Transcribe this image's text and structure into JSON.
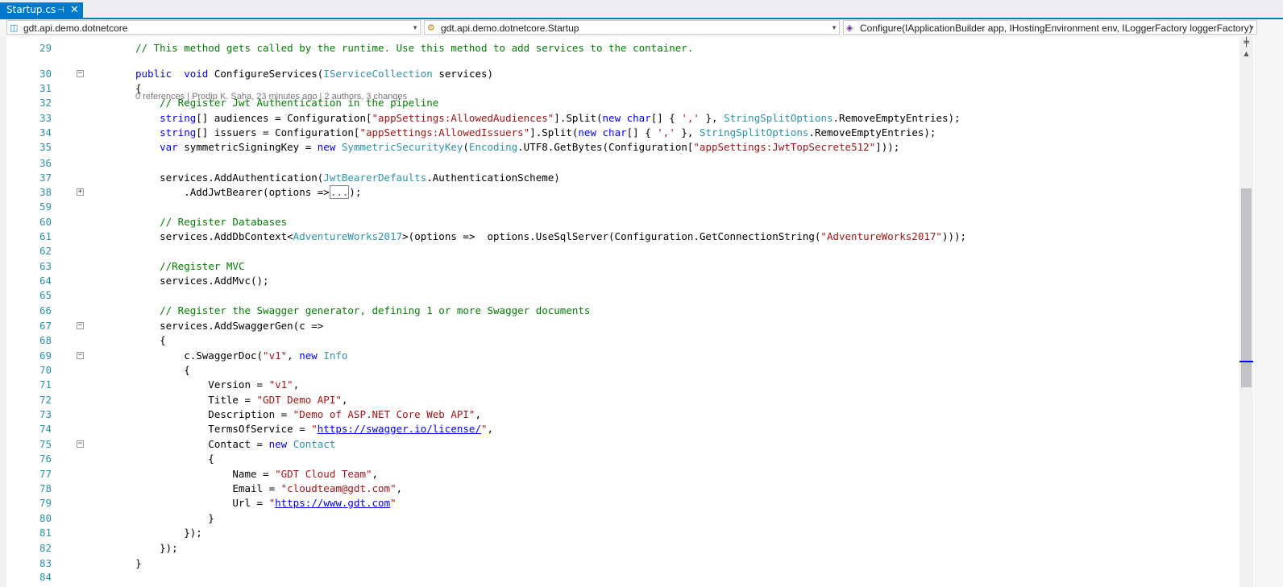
{
  "tab": {
    "title": "Startup.cs"
  },
  "nav": {
    "project": "gdt.api.demo.dotnetcore",
    "type": "gdt.api.demo.dotnetcore.Startup",
    "member": "Configure(IApplicationBuilder app, IHostingEnvironment env, ILoggerFactory loggerFactory)"
  },
  "codelens": "0 references | Prodip K. Saha, 23 minutes ago | 2 authors, 3 changes",
  "lines": [
    {
      "num": "29",
      "fold": "",
      "tokens": [
        [
          "cm",
          "// This method gets called by the runtime. Use this method to add services to the container."
        ]
      ]
    },
    {
      "num": "30",
      "fold": "-",
      "tokens": [
        [
          "kw",
          "public"
        ],
        [
          "",
          "  "
        ],
        [
          "kw",
          "void"
        ],
        [
          "",
          " ConfigureServices("
        ],
        [
          "ty",
          "IServiceCollection"
        ],
        [
          "",
          " services)"
        ]
      ]
    },
    {
      "num": "31",
      "fold": "",
      "tokens": [
        [
          "",
          "{"
        ]
      ]
    },
    {
      "num": "32",
      "fold": "",
      "tokens": [
        [
          "",
          "    "
        ],
        [
          "cm",
          "// Register Jwt Authentication in the pipeline"
        ]
      ]
    },
    {
      "num": "33",
      "fold": "",
      "tokens": [
        [
          "",
          "    "
        ],
        [
          "kw",
          "string"
        ],
        [
          "",
          "[] audiences = Configuration["
        ],
        [
          "str",
          "\"appSettings:AllowedAudiences\""
        ],
        [
          "",
          "].Split("
        ],
        [
          "kw",
          "new"
        ],
        [
          "",
          " "
        ],
        [
          "kw",
          "char"
        ],
        [
          "",
          "[] { "
        ],
        [
          "str",
          "','"
        ],
        [
          "",
          " }, "
        ],
        [
          "ty",
          "StringSplitOptions"
        ],
        [
          "",
          ".RemoveEmptyEntries);"
        ]
      ]
    },
    {
      "num": "34",
      "fold": "",
      "tokens": [
        [
          "",
          "    "
        ],
        [
          "kw",
          "string"
        ],
        [
          "",
          "[] issuers = Configuration["
        ],
        [
          "str",
          "\"appSettings:AllowedIssuers\""
        ],
        [
          "",
          "].Split("
        ],
        [
          "kw",
          "new"
        ],
        [
          "",
          " "
        ],
        [
          "kw",
          "char"
        ],
        [
          "",
          "[] { "
        ],
        [
          "str",
          "','"
        ],
        [
          "",
          " }, "
        ],
        [
          "ty",
          "StringSplitOptions"
        ],
        [
          "",
          ".RemoveEmptyEntries);"
        ]
      ]
    },
    {
      "num": "35",
      "fold": "",
      "tokens": [
        [
          "",
          "    "
        ],
        [
          "kw",
          "var"
        ],
        [
          "",
          " symmetricSigningKey = "
        ],
        [
          "kw",
          "new"
        ],
        [
          "",
          " "
        ],
        [
          "ty",
          "SymmetricSecurityKey"
        ],
        [
          "",
          "("
        ],
        [
          "ty",
          "Encoding"
        ],
        [
          "",
          ".UTF8.GetBytes(Configuration["
        ],
        [
          "str",
          "\"appSettings:JwtTopSecrete512\""
        ],
        [
          "",
          "]));"
        ]
      ]
    },
    {
      "num": "36",
      "fold": "",
      "tokens": []
    },
    {
      "num": "37",
      "fold": "",
      "tokens": [
        [
          "",
          "    services.AddAuthentication("
        ],
        [
          "ty",
          "JwtBearerDefaults"
        ],
        [
          "",
          ".AuthenticationScheme)"
        ]
      ]
    },
    {
      "num": "38",
      "fold": "+",
      "tokens": [
        [
          "",
          "        .AddJwtBearer(options =>"
        ],
        [
          "coll",
          "..."
        ],
        [
          "",
          ");"
        ]
      ]
    },
    {
      "num": "59",
      "fold": "",
      "tokens": []
    },
    {
      "num": "60",
      "fold": "",
      "tokens": [
        [
          "",
          "    "
        ],
        [
          "cm",
          "// Register Databases"
        ]
      ]
    },
    {
      "num": "61",
      "fold": "",
      "tokens": [
        [
          "",
          "    services.AddDbContext<"
        ],
        [
          "ty",
          "AdventureWorks2017"
        ],
        [
          "",
          ">(options =>  options.UseSqlServer(Configuration.GetConnectionString("
        ],
        [
          "str",
          "\"AdventureWorks2017\""
        ],
        [
          "",
          ")));"
        ]
      ]
    },
    {
      "num": "62",
      "fold": "",
      "tokens": []
    },
    {
      "num": "63",
      "fold": "",
      "tokens": [
        [
          "",
          "    "
        ],
        [
          "cm",
          "//Register MVC"
        ]
      ]
    },
    {
      "num": "64",
      "fold": "",
      "tokens": [
        [
          "",
          "    services.AddMvc();"
        ]
      ]
    },
    {
      "num": "65",
      "fold": "",
      "tokens": []
    },
    {
      "num": "66",
      "fold": "",
      "tokens": [
        [
          "",
          "    "
        ],
        [
          "cm",
          "// Register the Swagger generator, defining 1 or more Swagger documents"
        ]
      ]
    },
    {
      "num": "67",
      "fold": "-",
      "tokens": [
        [
          "",
          "    services.AddSwaggerGen(c =>"
        ]
      ]
    },
    {
      "num": "68",
      "fold": "",
      "tokens": [
        [
          "",
          "    {"
        ]
      ]
    },
    {
      "num": "69",
      "fold": "-",
      "tokens": [
        [
          "",
          "        c.SwaggerDoc("
        ],
        [
          "str",
          "\"v1\""
        ],
        [
          "",
          ", "
        ],
        [
          "kw",
          "new"
        ],
        [
          "",
          " "
        ],
        [
          "ty",
          "Info"
        ]
      ]
    },
    {
      "num": "70",
      "fold": "",
      "tokens": [
        [
          "",
          "        {"
        ]
      ]
    },
    {
      "num": "71",
      "fold": "",
      "tokens": [
        [
          "",
          "            Version = "
        ],
        [
          "str",
          "\"v1\""
        ],
        [
          "",
          ","
        ]
      ]
    },
    {
      "num": "72",
      "fold": "",
      "tokens": [
        [
          "",
          "            Title = "
        ],
        [
          "str",
          "\"GDT Demo API\""
        ],
        [
          "",
          ","
        ]
      ]
    },
    {
      "num": "73",
      "fold": "",
      "tokens": [
        [
          "",
          "            Description = "
        ],
        [
          "str",
          "\"Demo of ASP.NET Core Web API\""
        ],
        [
          "",
          ","
        ]
      ]
    },
    {
      "num": "74",
      "fold": "",
      "tokens": [
        [
          "",
          "            TermsOfService = "
        ],
        [
          "str",
          "\""
        ],
        [
          "url",
          "https://swagger.io/license/"
        ],
        [
          "str",
          "\""
        ],
        [
          "",
          ","
        ]
      ]
    },
    {
      "num": "75",
      "fold": "-",
      "tokens": [
        [
          "",
          "            Contact = "
        ],
        [
          "kw",
          "new"
        ],
        [
          "",
          " "
        ],
        [
          "ty",
          "Contact"
        ]
      ]
    },
    {
      "num": "76",
      "fold": "",
      "tokens": [
        [
          "",
          "            {"
        ]
      ]
    },
    {
      "num": "77",
      "fold": "",
      "tokens": [
        [
          "",
          "                Name = "
        ],
        [
          "str",
          "\"GDT Cloud Team\""
        ],
        [
          "",
          ","
        ]
      ]
    },
    {
      "num": "78",
      "fold": "",
      "tokens": [
        [
          "",
          "                Email = "
        ],
        [
          "str",
          "\"cloudteam@gdt.com\""
        ],
        [
          "",
          ","
        ]
      ]
    },
    {
      "num": "79",
      "fold": "",
      "tokens": [
        [
          "",
          "                Url = "
        ],
        [
          "str",
          "\""
        ],
        [
          "url",
          "https://www.gdt.com"
        ],
        [
          "str",
          "\""
        ]
      ]
    },
    {
      "num": "80",
      "fold": "",
      "tokens": [
        [
          "",
          "            }"
        ]
      ]
    },
    {
      "num": "81",
      "fold": "",
      "tokens": [
        [
          "",
          "        });"
        ]
      ]
    },
    {
      "num": "82",
      "fold": "",
      "tokens": [
        [
          "",
          "    });"
        ]
      ]
    },
    {
      "num": "83",
      "fold": "",
      "tokens": [
        [
          "",
          "}"
        ]
      ]
    },
    {
      "num": "84",
      "fold": "",
      "tokens": []
    }
  ],
  "colors": {
    "keyword": "#0000ff",
    "type": "#2b91af",
    "string": "#a31515",
    "comment": "#008000",
    "accent": "#007acc"
  },
  "icons": {
    "pin": "pin-icon",
    "close": "close-icon",
    "project": "csharp-project-icon",
    "type": "class-icon",
    "member": "method-icon"
  }
}
